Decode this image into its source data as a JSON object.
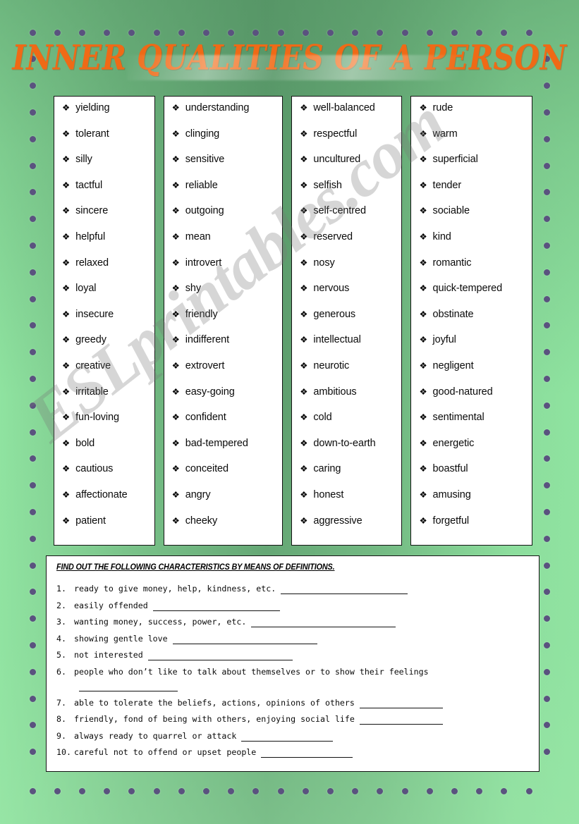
{
  "page": {
    "title": "INNER QUALITIES OF A PERSON",
    "background_color_light": "#8fe3a0",
    "background_color_dark": "#5f9e6e",
    "title_color": "#ef6a16",
    "dot_color": "#5a527f",
    "watermark": "ESLprintables.com"
  },
  "columns": [
    {
      "id": "column-1",
      "bullet": "❖",
      "words": [
        "yielding",
        "tolerant",
        "silly",
        "tactful",
        "sincere",
        "helpful",
        "relaxed",
        "loyal",
        "insecure",
        "greedy",
        "creative",
        "irritable",
        "fun-loving",
        "bold",
        "cautious",
        "affectionate",
        "patient"
      ]
    },
    {
      "id": "column-2",
      "bullet": "❖",
      "words": [
        "understanding",
        "clinging",
        "sensitive",
        "reliable",
        "outgoing",
        "mean",
        "introvert",
        "shy",
        "friendly",
        "indifferent",
        "extrovert",
        "easy-going",
        "confident",
        "bad-tempered",
        "conceited",
        "angry",
        "cheeky"
      ]
    },
    {
      "id": "column-3",
      "bullet": "❖",
      "words": [
        "well-balanced",
        "respectful",
        "uncultured",
        "selfish",
        "self-centred",
        "reserved",
        "nosy",
        "nervous",
        "generous",
        "intellectual",
        "neurotic",
        "ambitious",
        "cold",
        "down-to-earth",
        "caring",
        "honest",
        "aggressive"
      ]
    },
    {
      "id": "column-4",
      "bullet": "❖",
      "words": [
        "rude",
        "warm",
        "superficial",
        "tender",
        "sociable",
        "kind",
        "romantic",
        "quick-tempered",
        "obstinate",
        "joyful",
        "negligent",
        "good-natured",
        "sentimental",
        "energetic",
        "boastful",
        "amusing",
        "forgetful"
      ]
    }
  ],
  "exercise": {
    "heading": "FIND OUT THE FOLLOWING CHARACTERISTICS BY MEANS OF DEFINITIONS.",
    "items": [
      {
        "num": "1.",
        "text": "ready to give money, help, kindness, etc.",
        "blank_width": 180,
        "indent": false
      },
      {
        "num": "2.",
        "text": "easily offended",
        "blank_width": 180,
        "indent": false
      },
      {
        "num": "3.",
        "text": "wanting money, success, power, etc.",
        "blank_width": 205,
        "indent": false
      },
      {
        "num": "4.",
        "text": "showing gentle love",
        "blank_width": 205,
        "indent": false
      },
      {
        "num": "5.",
        "text": "not interested",
        "blank_width": 205,
        "indent": false
      },
      {
        "num": "6.",
        "text": "people who don’t like to talk about themselves or to show their feelings",
        "blank_width": 0,
        "indent": false
      },
      {
        "num": "",
        "text": "",
        "blank_width": 140,
        "indent": true
      },
      {
        "num": "7.",
        "text": "able to tolerate the beliefs, actions, opinions of others",
        "blank_width": 118,
        "indent": false
      },
      {
        "num": "8.",
        "text": "friendly, fond of being with others, enjoying social life",
        "blank_width": 118,
        "indent": false
      },
      {
        "num": "9.",
        "text": "always ready to quarrel or attack",
        "blank_width": 130,
        "indent": false
      },
      {
        "num": "10.",
        "text": "careful not to offend or upset people",
        "blank_width": 130,
        "indent": false
      }
    ]
  }
}
